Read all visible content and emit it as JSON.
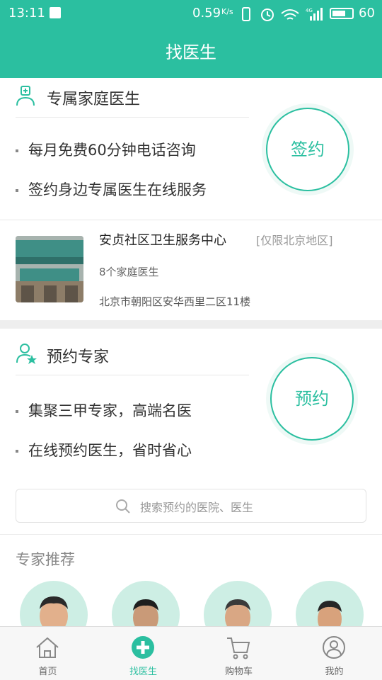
{
  "status_bar": {
    "time": "13:11",
    "speed": "0.59",
    "speed_unit": "K/s",
    "network": "4G",
    "battery": "60"
  },
  "header": {
    "title": "找医生"
  },
  "family_doctor": {
    "title": "专属家庭医生",
    "bullets": [
      "每月免费60分钟电话咨询",
      "签约身边专属医生在线服务"
    ],
    "action_label": "签约"
  },
  "center": {
    "name": "安贞社区卫生服务中心",
    "tag": "[仅限北京地区]",
    "doctor_count": "8个家庭医生",
    "address": "北京市朝阳区安华西里二区11楼"
  },
  "expert": {
    "title": "预约专家",
    "bullets": [
      "集聚三甲专家，高端名医",
      "在线预约医生，省时省心"
    ],
    "action_label": "预约",
    "search_placeholder": "搜索预约的医院、医生"
  },
  "recommend": {
    "title": "专家推荐"
  },
  "tabbar": {
    "items": [
      {
        "label": "首页",
        "icon": "home-icon"
      },
      {
        "label": "找医生",
        "icon": "plus-cross-icon"
      },
      {
        "label": "购物车",
        "icon": "cart-icon"
      },
      {
        "label": "我的",
        "icon": "profile-icon"
      }
    ],
    "active_index": 1
  },
  "colors": {
    "accent": "#2bbfa0"
  }
}
